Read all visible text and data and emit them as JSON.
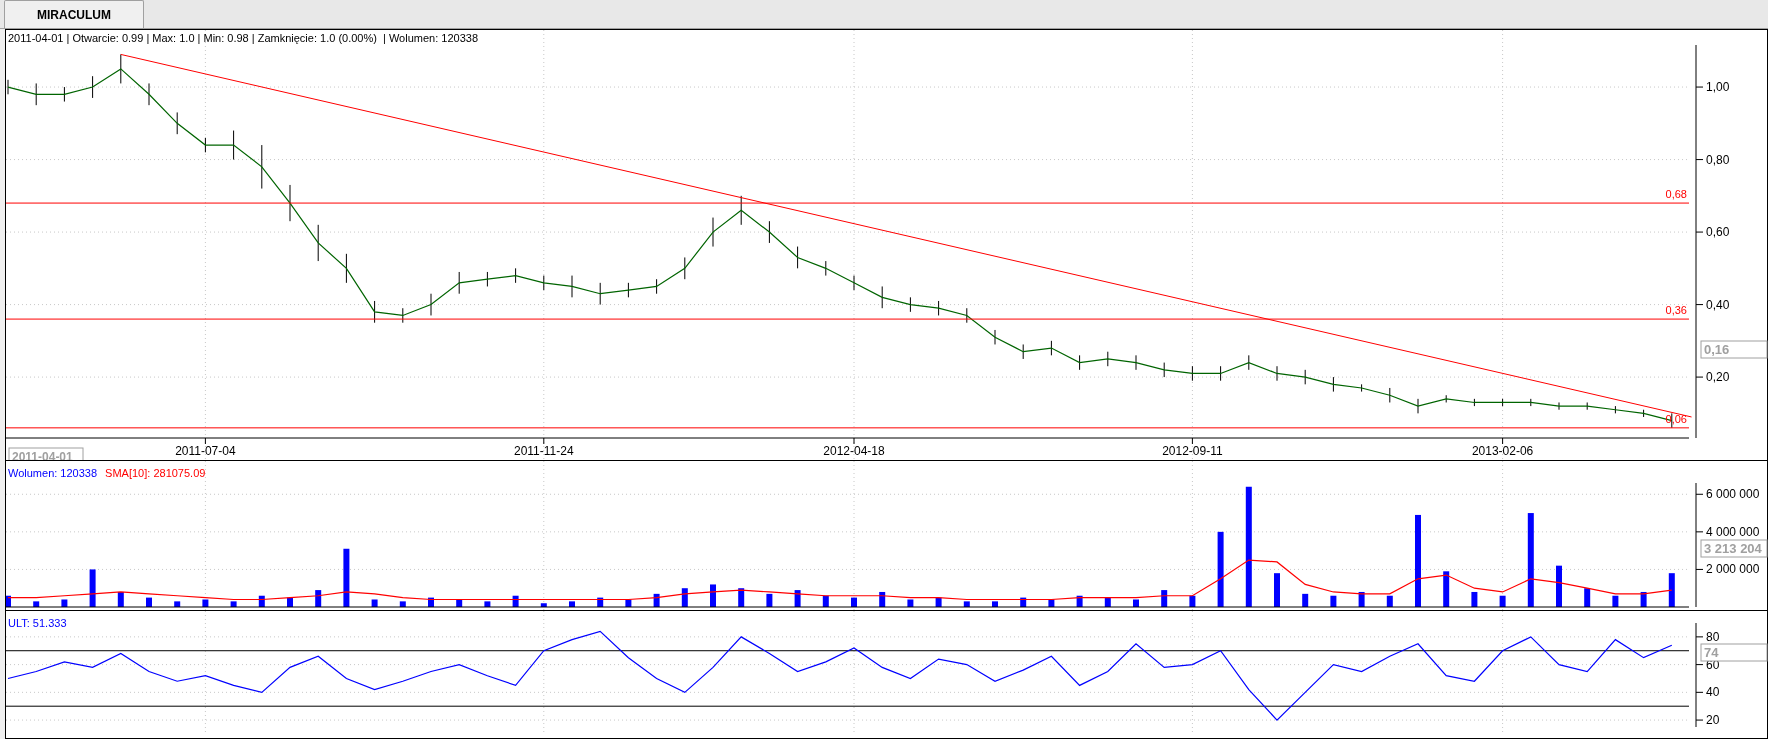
{
  "tab": {
    "label": "MIRACULUM",
    "selected": true
  },
  "price_panel": {
    "info": "2011-04-01 | Otwarcie: 0.99 | Max: 1.0 | Min: 0.98 | Zamknięcie: 1.0 (0.00%)  | Wolumen: 120338",
    "cursor_date": "2011-04-01",
    "last_value": "0,16",
    "chart_data": {
      "type": "line",
      "grid": true,
      "categories": [
        null,
        null,
        null,
        null,
        null,
        null,
        null,
        "2011-07-04",
        null,
        null,
        null,
        null,
        null,
        null,
        null,
        null,
        null,
        null,
        null,
        "2011-11-24",
        null,
        null,
        null,
        null,
        null,
        null,
        null,
        null,
        null,
        null,
        "2012-04-18",
        null,
        null,
        null,
        null,
        null,
        null,
        null,
        null,
        null,
        null,
        null,
        "2012-09-11",
        null,
        null,
        null,
        null,
        null,
        null,
        null,
        null,
        null,
        null,
        "2013-02-06",
        null,
        null,
        null,
        null,
        null,
        null
      ],
      "series": [
        {
          "color": "#006400",
          "errors": [
            0.02,
            0.03,
            0.02,
            0.03,
            0.04,
            0.03,
            0.03,
            0.02,
            0.04,
            0.06,
            0.05,
            0.05,
            0.04,
            0.03,
            0.02,
            0.03,
            0.03,
            0.02,
            0.02,
            0.02,
            0.03,
            0.03,
            0.02,
            0.02,
            0.03,
            0.04,
            0.04,
            0.03,
            0.03,
            0.02,
            0.02,
            0.03,
            0.02,
            0.02,
            0.02,
            0.02,
            0.02,
            0.02,
            0.02,
            0.02,
            0.02,
            0.02,
            0.02,
            0.02,
            0.02,
            0.02,
            0.02,
            0.02,
            0.01,
            0.02,
            0.02,
            0.01,
            0.01,
            0.01,
            0.01,
            0.01,
            0.01,
            0.01,
            0.01,
            0.02
          ],
          "values": [
            1.0,
            0.98,
            0.98,
            1.0,
            1.05,
            0.98,
            0.9,
            0.84,
            0.84,
            0.78,
            0.68,
            0.57,
            0.5,
            0.38,
            0.37,
            0.4,
            0.46,
            0.47,
            0.48,
            0.46,
            0.45,
            0.43,
            0.44,
            0.45,
            0.5,
            0.6,
            0.66,
            0.6,
            0.53,
            0.5,
            0.46,
            0.42,
            0.4,
            0.39,
            0.37,
            0.31,
            0.27,
            0.28,
            0.24,
            0.25,
            0.24,
            0.22,
            0.21,
            0.21,
            0.24,
            0.21,
            0.2,
            0.18,
            0.17,
            0.15,
            0.12,
            0.14,
            0.13,
            0.13,
            0.13,
            0.12,
            0.12,
            0.11,
            0.1,
            0.08
          ]
        }
      ],
      "ylim": [
        0.032,
        1.116
      ],
      "yticks": [
        {
          "value": 0.2,
          "label": "0,20"
        },
        {
          "value": 0.4,
          "label": "0,40"
        },
        {
          "value": 0.6,
          "label": "0,60"
        },
        {
          "value": 0.8,
          "label": "0,80"
        },
        {
          "value": 1.0,
          "label": "1,00"
        }
      ],
      "ref_lines": [
        {
          "axis": "y",
          "value": 0.68,
          "label": "0,68",
          "color": "#ff0000"
        },
        {
          "axis": "y",
          "value": 0.36,
          "label": "0,36",
          "color": "#ff0000"
        },
        {
          "axis": "y",
          "value": 0.06,
          "label": "0,06",
          "color": "#ff0000"
        }
      ]
    }
  },
  "volume_panel": {
    "label": "Wolumen: 120338",
    "sma_label": "SMA[10]: 281075.09",
    "last_value": "3 213 204",
    "chart_data": {
      "type": "bar",
      "grid": true,
      "ylim": [
        0,
        6600000
      ],
      "series": [
        {
          "color": "#0000ff",
          "values": [
            600000,
            300000,
            400000,
            2000000,
            800000,
            500000,
            300000,
            400000,
            300000,
            600000,
            500000,
            900000,
            3100000,
            400000,
            300000,
            500000,
            400000,
            300000,
            600000,
            200000,
            300000,
            500000,
            400000,
            700000,
            1000000,
            1200000,
            1000000,
            700000,
            900000,
            600000,
            500000,
            800000,
            400000,
            500000,
            300000,
            300000,
            500000,
            400000,
            600000,
            500000,
            400000,
            900000,
            600000,
            4000000,
            6400000,
            1800000,
            700000,
            600000,
            800000,
            600000,
            4900000,
            1900000,
            800000,
            600000,
            5000000,
            2200000,
            1000000,
            600000,
            800000,
            1800000
          ]
        },
        {
          "type": "line",
          "color": "#ff0000",
          "values": [
            500000,
            500000,
            600000,
            700000,
            800000,
            700000,
            600000,
            500000,
            400000,
            400000,
            500000,
            600000,
            800000,
            700000,
            500000,
            400000,
            400000,
            400000,
            400000,
            400000,
            400000,
            400000,
            400000,
            500000,
            700000,
            800000,
            900000,
            800000,
            700000,
            600000,
            600000,
            600000,
            500000,
            500000,
            400000,
            400000,
            400000,
            400000,
            500000,
            500000,
            500000,
            600000,
            600000,
            1500000,
            2500000,
            2400000,
            1200000,
            800000,
            700000,
            700000,
            1500000,
            1700000,
            1000000,
            800000,
            1500000,
            1300000,
            1000000,
            700000,
            700000,
            900000
          ]
        }
      ],
      "yticks": [
        {
          "value": 2000000,
          "label": "2 000 000"
        },
        {
          "value": 4000000,
          "label": "4 000 000"
        },
        {
          "value": 6000000,
          "label": "6 000 000"
        }
      ]
    }
  },
  "ult_panel": {
    "label": "ULT: 51.333",
    "last_value": "74",
    "chart_data": {
      "type": "line",
      "grid": true,
      "series": [
        {
          "color": "#0000ff",
          "values": [
            50,
            55,
            62,
            58,
            68,
            55,
            48,
            52,
            45,
            40,
            58,
            66,
            50,
            42,
            48,
            55,
            60,
            52,
            45,
            70,
            78,
            84,
            65,
            50,
            40,
            58,
            80,
            68,
            55,
            62,
            72,
            58,
            50,
            64,
            60,
            48,
            56,
            66,
            45,
            55,
            75,
            58,
            60,
            70,
            42,
            20,
            40,
            60,
            55,
            66,
            75,
            52,
            48,
            70,
            80,
            60,
            55,
            78,
            65,
            74
          ]
        }
      ],
      "ylim": [
        15,
        90
      ],
      "yticks": [
        {
          "value": 20,
          "label": "20"
        },
        {
          "value": 40,
          "label": "40"
        },
        {
          "value": 60,
          "label": "60"
        },
        {
          "value": 80,
          "label": "80"
        }
      ],
      "ref_lines": [
        {
          "axis": "y",
          "value": 70,
          "color": "#000000"
        },
        {
          "axis": "y",
          "value": 30,
          "color": "#000000"
        }
      ]
    }
  }
}
